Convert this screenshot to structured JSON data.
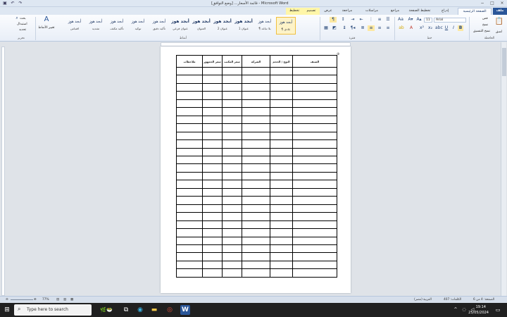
{
  "window": {
    "title": "قائمة الأسعار... [وضع التوافق] - Microsoft Word",
    "minimize": "−",
    "maximize": "□",
    "close": "×"
  },
  "tabs": [
    "ملف",
    "الصفحة الرئيسية",
    "إدراج",
    "تخطيط الصفحة",
    "مراجع",
    "مراسلات",
    "مراجعة",
    "عرض",
    "تصميم",
    "تخطيط"
  ],
  "ribbon": {
    "clipboard": {
      "label": "الحافظة",
      "paste": "لصق",
      "cut": "قص",
      "copy": "نسخ",
      "format_painter": "نسخ التنسيق"
    },
    "font": {
      "label": "خط",
      "font_name": "Arial",
      "font_size": "11"
    },
    "paragraph": {
      "label": "فقرة"
    },
    "styles": {
      "label": "أنماط",
      "items": [
        {
          "sample": "أبجد هوز",
          "name": "¶ عادي"
        },
        {
          "sample": "أبجد هوز",
          "name": "¶ بلا تباعد"
        },
        {
          "sample": "أبجد هوز",
          "name": "عنوان 1"
        },
        {
          "sample": "أبجد هوز",
          "name": "عنوان 2"
        },
        {
          "sample": "أبجد هوز",
          "name": "العنوان"
        },
        {
          "sample": "أبجد هوز",
          "name": "عنوان فرعي"
        },
        {
          "sample": "أبجد هوز",
          "name": "تأكيد دقيق"
        },
        {
          "sample": "أبجد هوز",
          "name": "توكيد"
        },
        {
          "sample": "أبجد هوز",
          "name": "تأكيد مكثف"
        },
        {
          "sample": "أبجد هوز",
          "name": "تشديد"
        },
        {
          "sample": "أبجد هوز",
          "name": "اقتباس"
        }
      ],
      "change_styles": "تغيير الأنماط"
    },
    "editing": {
      "label": "تحرير",
      "find": "بحث",
      "replace": "استبدال",
      "select": "تحديد"
    }
  },
  "table": {
    "headers": [
      "الصنف",
      "النوع / الحجم",
      "الشركة",
      "سعر المكتب",
      "سعر الجمهور",
      "ملاحظات"
    ],
    "empty_rows": 26
  },
  "statusbar": {
    "page": "الصفحة: 4 من 6",
    "words": "الكلمات: 407",
    "language": "العربية (مصر)",
    "zoom": "77%"
  },
  "taskbar": {
    "search_placeholder": "Type here to search",
    "time": "19:14",
    "date": "25/05/2024"
  }
}
